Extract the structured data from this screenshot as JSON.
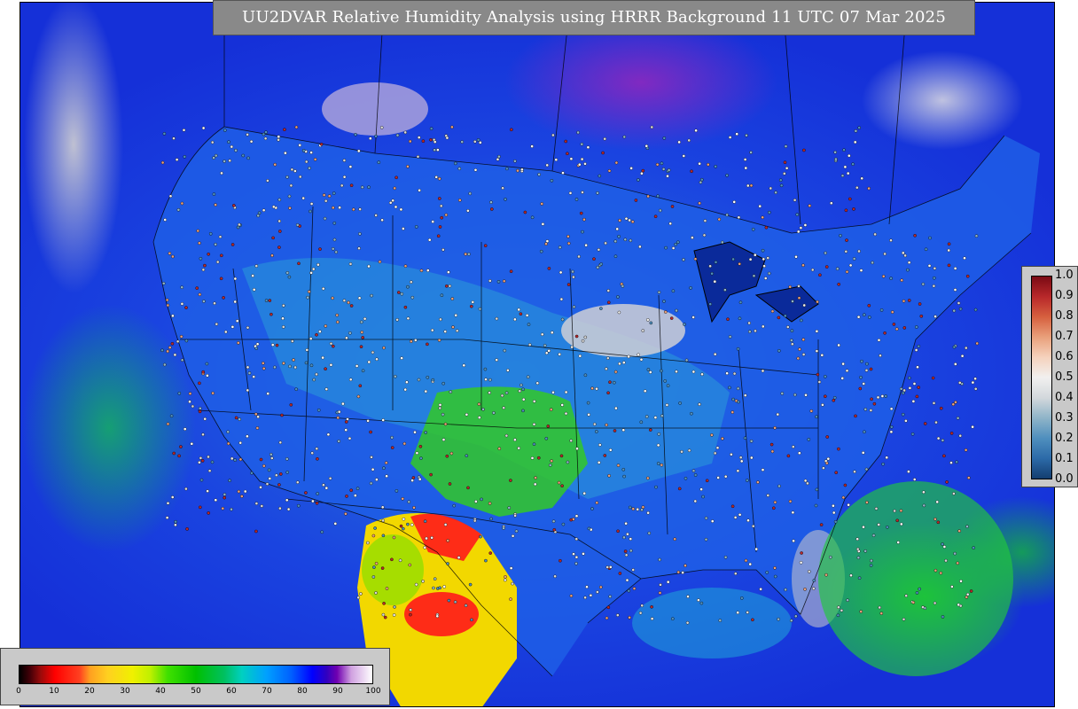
{
  "title": "UU2DVAR Relative Humidity Analysis using HRRR Background 11 UTC 07 Mar 2025",
  "obs_colorbar": {
    "ticks": [
      "1.0",
      "0.9",
      "0.8",
      "0.7",
      "0.6",
      "0.5",
      "0.4",
      "0.3",
      "0.2",
      "0.1",
      "0.0"
    ],
    "range": [
      0.0,
      1.0
    ]
  },
  "rh_colorbar": {
    "ticks": [
      "0",
      "10",
      "20",
      "30",
      "40",
      "50",
      "60",
      "70",
      "80",
      "90",
      "100"
    ],
    "range": [
      0,
      100
    ],
    "units": "%"
  },
  "colors": {
    "ocean_high_rh": "#1a44e0",
    "dry_southwest": "#f0f000",
    "very_dry": "#ff0000",
    "moist_gulf_atlantic": "#14c828",
    "saturated": "#d4d4d8"
  }
}
